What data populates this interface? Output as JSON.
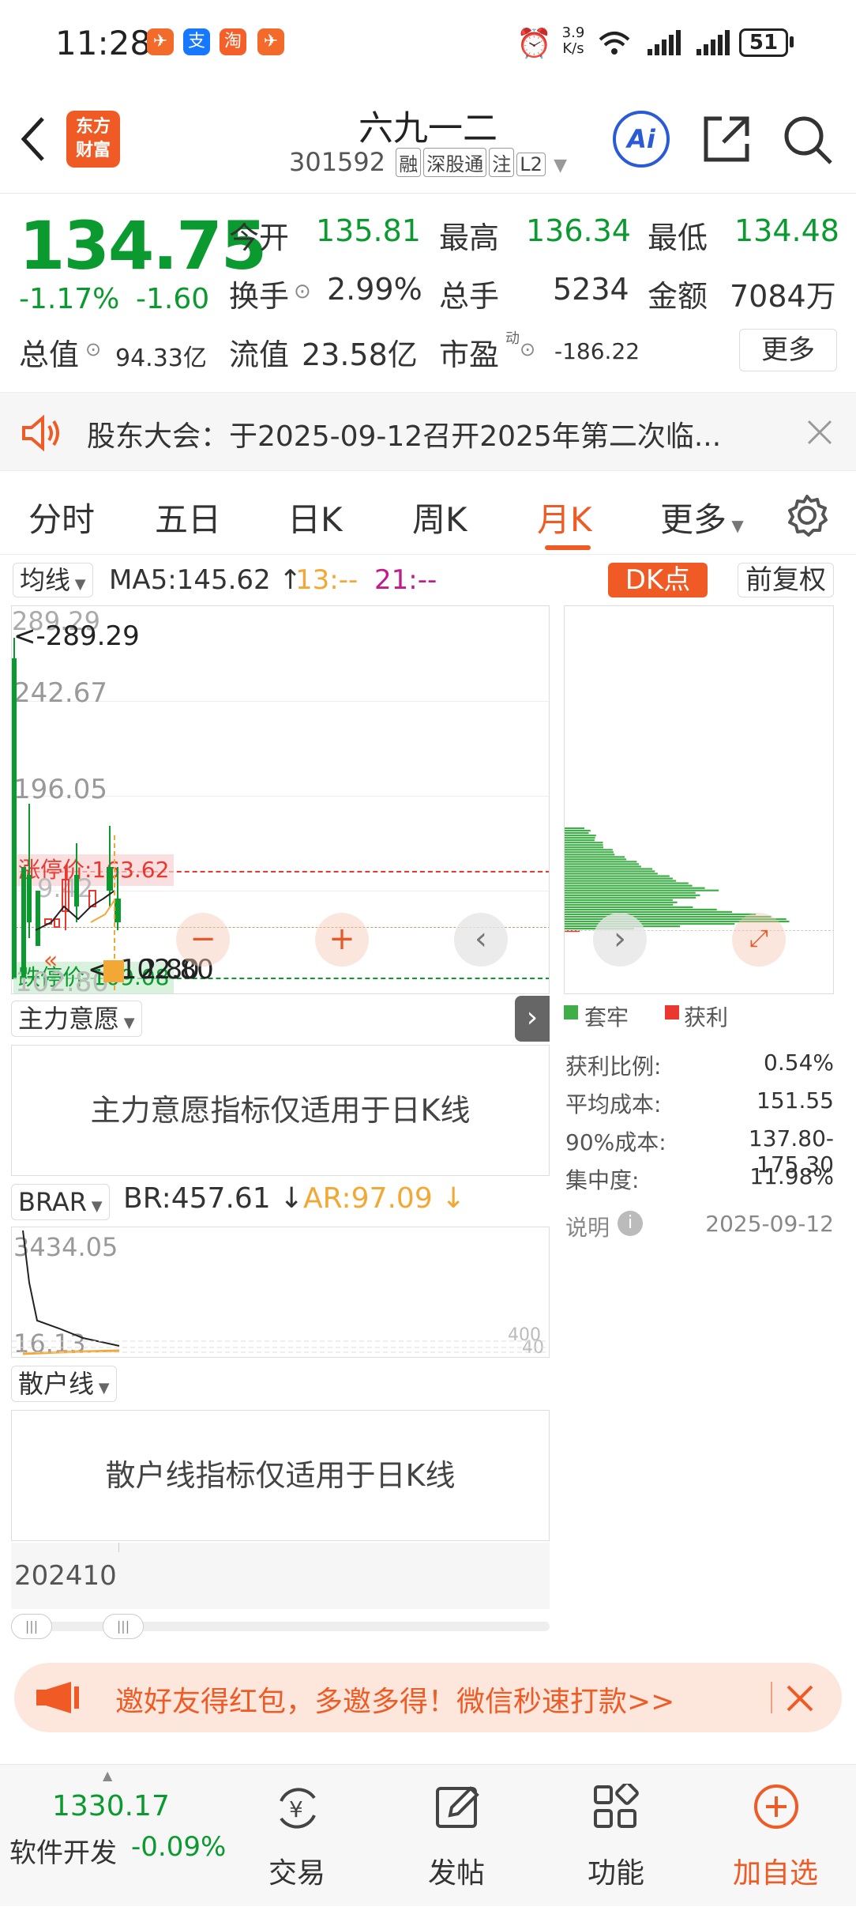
{
  "status_bar": {
    "time": "11:28",
    "net_speed_top": "3.9",
    "net_speed_bottom": "K/s",
    "battery": "51"
  },
  "header": {
    "logo_line1": "东方",
    "logo_line2": "财富",
    "stock_name": "六九一二",
    "stock_code": "301592",
    "tags": [
      "融",
      "深股通",
      "注",
      "L2"
    ],
    "ai_label": "Ai"
  },
  "quote": {
    "price": "134.75",
    "change_pct": "-1.17%",
    "change": "-1.60",
    "open_label": "今开",
    "open": "135.81",
    "high_label": "最高",
    "high": "136.34",
    "low_label": "最低",
    "low": "134.48",
    "turnover_label": "换手",
    "turnover": "2.99%",
    "volume_label": "总手",
    "volume": "5234",
    "amount_label": "金额",
    "amount": "7084万",
    "total_cap_label": "总值",
    "total_cap": "94.33亿",
    "float_cap_label": "流值",
    "float_cap": "23.58亿",
    "pe_label": "市盈",
    "pe_sup": "动",
    "pe": "-186.22",
    "more_label": "更多"
  },
  "notice": {
    "text": "股东大会：于2025-09-12召开2025年第二次临..."
  },
  "tabs": [
    "分时",
    "五日",
    "日K",
    "周K",
    "月K",
    "更多"
  ],
  "active_tab": "月K",
  "chart": {
    "indicator_select": "均线",
    "ma5": "MA5:145.62",
    "ma13": "13:--",
    "ma21": "21:--",
    "dk_button": "DK点",
    "adjust_button": "前复权",
    "y_labels": [
      "289.29",
      "242.67",
      "196.05"
    ],
    "max_marker": "<-289.29",
    "limit_up": "涨停价:163.62",
    "limit_down": "跌停价:109.08",
    "price_fragments": [
      "9.42",
      "2.80",
      "102.80"
    ],
    "min_marker": "<-102.80",
    "colors": {
      "up": "#e8382f",
      "down": "#0a9a2f",
      "accent": "#ef5a25"
    }
  },
  "chip_panel": {
    "legend_trapped": "套牢",
    "legend_profit": "获利",
    "rows": [
      {
        "label": "获利比例:",
        "value": "0.54%"
      },
      {
        "label": "平均成本:",
        "value": "151.55"
      },
      {
        "label": "90%成本:",
        "value": "137.80-175.30"
      },
      {
        "label": "集中度:",
        "value": "11.98%"
      }
    ],
    "note_label": "说明",
    "date": "2025-09-12"
  },
  "main_force": {
    "select": "主力意愿",
    "message": "主力意愿指标仅适用于日K线"
  },
  "brar": {
    "select": "BRAR",
    "br": "BR:457.61",
    "ar": "AR:97.09",
    "top_value": "3434.05",
    "bottom_value": "16.13",
    "right_top": "400",
    "right_bottom": "40"
  },
  "retail": {
    "select": "散户线",
    "message": "散户线指标仅适用于日K线"
  },
  "timeline": {
    "date": "202410"
  },
  "banner": {
    "text": "邀好友得红包，多邀多得！微信秒速打款>>"
  },
  "bottom_nav": {
    "index_value": "1330.17",
    "index_name": "软件开发",
    "index_change": "-0.09%",
    "items": [
      "交易",
      "发帖",
      "功能",
      "加自选"
    ]
  }
}
